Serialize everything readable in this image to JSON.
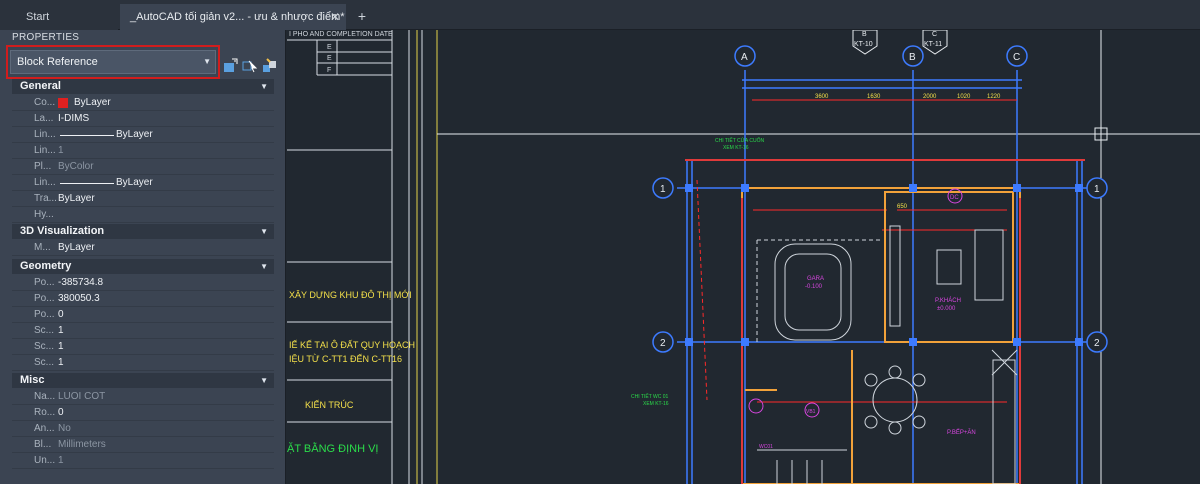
{
  "tabs": {
    "start": "Start",
    "active": "_AutoCAD tối giản v2... - ưu & nhược điểm*"
  },
  "properties": {
    "title": "PROPERTIES",
    "selected_type": "Block Reference",
    "sections": {
      "general": "General",
      "visualization": "3D Visualization",
      "geometry": "Geometry",
      "misc": "Misc"
    },
    "general": [
      {
        "key": "Co...",
        "value": "ByLayer",
        "swatch": "#e02020"
      },
      {
        "key": "La...",
        "value": "I-DIMS"
      },
      {
        "key": "Lin...",
        "value": "ByLayer",
        "line": true
      },
      {
        "key": "Lin...",
        "value": "1",
        "dim": true
      },
      {
        "key": "Pl...",
        "value": "ByColor",
        "dim": true
      },
      {
        "key": "Lin...",
        "value": "ByLayer",
        "line": true
      },
      {
        "key": "Tra...",
        "value": "ByLayer"
      },
      {
        "key": "Hy...",
        "value": ""
      }
    ],
    "visualization": [
      {
        "key": "M...",
        "value": "ByLayer"
      }
    ],
    "geometry": [
      {
        "key": "Po...",
        "value": "-385734.8"
      },
      {
        "key": "Po...",
        "value": "380050.3"
      },
      {
        "key": "Po...",
        "value": "0"
      },
      {
        "key": "Sc...",
        "value": "1"
      },
      {
        "key": "Sc...",
        "value": "1"
      },
      {
        "key": "Sc...",
        "value": "1"
      }
    ],
    "misc": [
      {
        "key": "Na...",
        "value": "LUOI COT",
        "dim": true
      },
      {
        "key": "Ro...",
        "value": "0"
      },
      {
        "key": "An...",
        "value": "No",
        "dim": true
      },
      {
        "key": "Bl...",
        "value": "Millimeters",
        "dim": true
      },
      {
        "key": "Un...",
        "value": "1",
        "dim": true
      }
    ]
  },
  "drawing": {
    "grid_labels": [
      "A",
      "B",
      "C",
      "1",
      "1",
      "2",
      "2"
    ],
    "section_markers": [
      "B",
      "KT-10",
      "C",
      "KT-11"
    ],
    "title_block": {
      "header": "I PHO AND COMPLETION DATE",
      "rows": [
        "E",
        "E",
        "F"
      ],
      "project": "XÂY DỰNG KHU ĐÔ THỊ MỚI",
      "desc_1": "IẾ KẾ TẠI Ô ĐẤT QUY HOẠCH",
      "desc_2": "IỆU TỪ C-TT1 ĐẾN C-TT16",
      "discipline": "KIẾN TRÚC",
      "sheet": "ẶT BẰNG ĐỊNH VỊ"
    },
    "labels": {
      "detail_1": "CHI TIẾT CỬA CUỐN",
      "detail_1b": "XEM KT-16",
      "garage": "GARA",
      "garage_level": "-0.100",
      "guest": "P.KHÁCH",
      "guest_level": "±0.000",
      "detail_2": "CHI TIẾT WC 01",
      "detail_2b": "XEM KT-16",
      "kitchen": "P.BẾP+ĂN",
      "tag_dc": "DC",
      "tag_vb1": "VB1",
      "tag_wc": "WC01"
    },
    "dims": [
      "3600",
      "1630",
      "2000",
      "1020",
      "1220",
      "650"
    ],
    "colors": {
      "grid_blue": "#3d7bff",
      "wall_orange": "#f2a23a",
      "wall_red": "#e03a3a",
      "dim_red": "#ff2a2a",
      "green_text": "#2bdc4a",
      "magenta": "#d846e0",
      "yellow_text": "#f4e04a"
    }
  }
}
